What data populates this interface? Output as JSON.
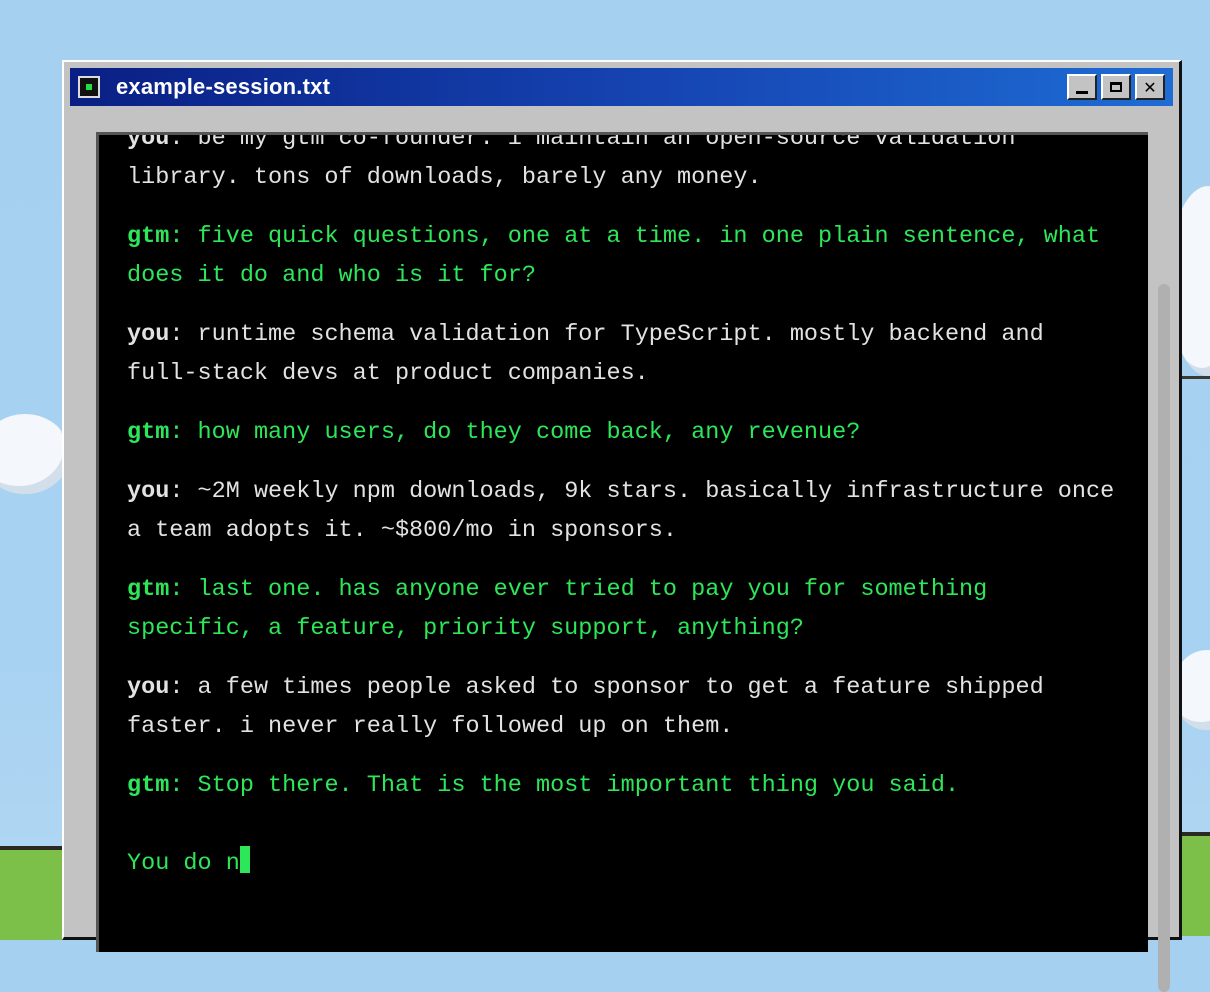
{
  "window": {
    "title": "example-session.txt",
    "controls": {
      "minimize": "_",
      "maximize": "□",
      "close": "✕"
    }
  },
  "session": {
    "messages": [
      {
        "speaker": "you",
        "text": "be my gtm co-founder. i maintain an open-source validation library. tons of downloads, barely any money."
      },
      {
        "speaker": "gtm",
        "text": "five quick questions, one at a time. in one plain sentence, what does it do and who is it for?"
      },
      {
        "speaker": "you",
        "text": "runtime schema validation for TypeScript. mostly backend and full-stack devs at product companies."
      },
      {
        "speaker": "gtm",
        "text": "how many users, do they come back, any revenue?"
      },
      {
        "speaker": "you",
        "text": "~2M weekly npm downloads, 9k stars. basically infrastructure once a team adopts it. ~$800/mo in sponsors."
      },
      {
        "speaker": "gtm",
        "text": "last one. has anyone ever tried to pay you for something specific, a feature, priority support, anything?"
      },
      {
        "speaker": "you",
        "text": "a few times people asked to sponsor to get a feature shipped faster. i never really followed up on them."
      },
      {
        "speaker": "gtm",
        "text": "Stop there. That is the most important thing you said."
      }
    ],
    "typing": "You do n"
  },
  "colors": {
    "terminal_bg": "#000000",
    "gtm_text": "#2ee65a",
    "you_text": "#e2e2e2",
    "titlebar": "#1646b4"
  },
  "icons": {
    "app": "terminal-icon",
    "minimize": "minimize-icon",
    "maximize": "maximize-icon",
    "close": "close-icon"
  }
}
